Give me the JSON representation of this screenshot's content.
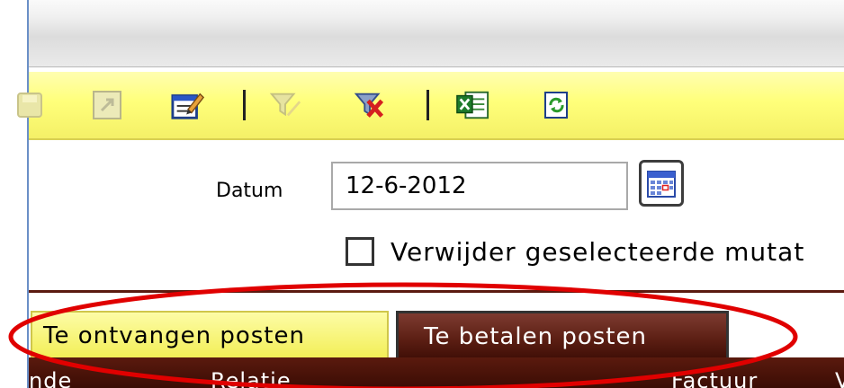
{
  "toolbar": {
    "buttons": [
      {
        "icon": "save-icon",
        "enabled": false
      },
      {
        "icon": "open-icon",
        "enabled": false
      },
      {
        "icon": "edit-icon",
        "enabled": true
      },
      {
        "icon": "filter-icon",
        "enabled": false
      },
      {
        "icon": "clear-filter-icon",
        "enabled": true
      },
      {
        "icon": "excel-export-icon",
        "enabled": true
      },
      {
        "icon": "refresh-icon",
        "enabled": true
      }
    ]
  },
  "form": {
    "date_label": "Datum",
    "date_value": "12-6-2012",
    "checkbox_label": "Verwijder geselecteerde mutat",
    "checkbox_checked": false
  },
  "tabs": [
    {
      "label": "Te ontvangen posten",
      "active": true
    },
    {
      "label": "Te betalen posten",
      "active": false
    }
  ],
  "table": {
    "columns": [
      "nde",
      "Relatie",
      "Factuur",
      "V"
    ]
  },
  "colors": {
    "toolbar_bg": "#ffff7a",
    "active_tab_bg": "#f2ee54",
    "inactive_tab_bg": "#5a1d12",
    "header_bg": "#3b0c04",
    "highlight_oval": "#e00000"
  }
}
